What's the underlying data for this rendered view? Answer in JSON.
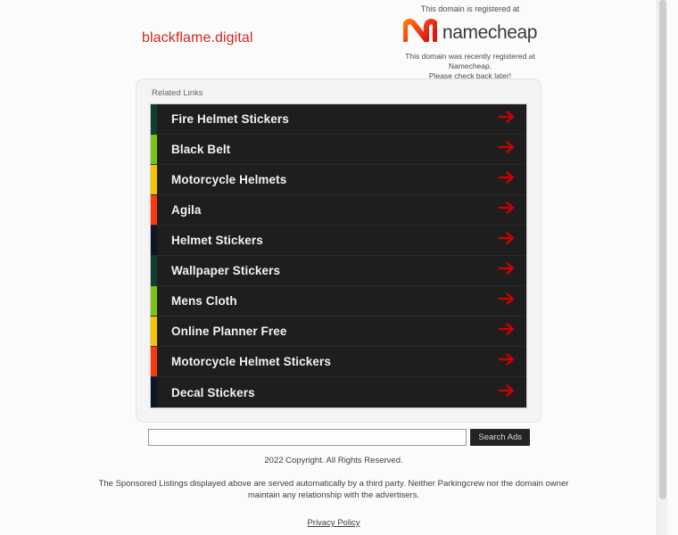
{
  "header": {
    "domain": "blackflame.digital",
    "registered_at_text": "This domain is registered at",
    "brand_name": "namecheap",
    "notice_line1": "This domain was recently registered at Namecheap.",
    "notice_line2": "Please check back later!",
    "brand_color_start": "#ff6a00",
    "brand_color_end": "#e01e1e",
    "domain_color": "#d0281e"
  },
  "card": {
    "title": "Related Links",
    "arrow_color": "#cc0000",
    "row_background": "#1e1e1e",
    "links": [
      {
        "label": "Fire Helmet Stickers",
        "accent": "#0d4031"
      },
      {
        "label": "Black Belt",
        "accent": "#7bc214"
      },
      {
        "label": "Motorcycle Helmets",
        "accent": "#f5c400"
      },
      {
        "label": "Agila",
        "accent": "#f93a13"
      },
      {
        "label": "Helmet Stickers",
        "accent": "#0b1824"
      },
      {
        "label": "Wallpaper Stickers",
        "accent": "#0d4031"
      },
      {
        "label": "Mens Cloth",
        "accent": "#7bc214"
      },
      {
        "label": "Online Planner Free",
        "accent": "#f5c400"
      },
      {
        "label": "Motorcycle Helmet Stickers",
        "accent": "#f93a13"
      },
      {
        "label": "Decal Stickers",
        "accent": "#0b1824"
      }
    ]
  },
  "search": {
    "value": "",
    "placeholder": "",
    "button_label": "Search Ads"
  },
  "footer": {
    "copyright": "2022 Copyright. All Rights Reserved.",
    "disclaimer": "The Sponsored Listings displayed above are served automatically by a third party. Neither Parkingcrew nor the domain owner maintain any relationship with the advertisers.",
    "privacy_label": "Privacy Policy"
  }
}
